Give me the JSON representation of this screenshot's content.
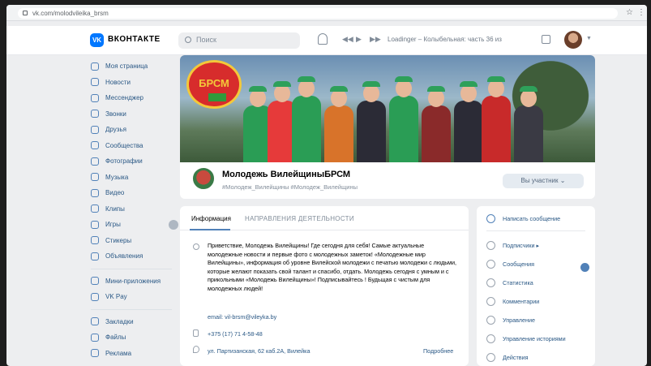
{
  "browser": {
    "url": "vk.com/molodvileika_brsm"
  },
  "header": {
    "logo_letters": "VK",
    "brand": "ВКОНТАКТЕ",
    "search_placeholder": "Поиск",
    "now_playing": "Loadinger – Колыбельная: часть 36 из"
  },
  "left_nav": {
    "items": [
      {
        "label": "Моя страница",
        "icon": "home-icon"
      },
      {
        "label": "Новости",
        "icon": "news-icon"
      },
      {
        "label": "Мессенджер",
        "icon": "chat-icon"
      },
      {
        "label": "Звонки",
        "icon": "phone-icon"
      },
      {
        "label": "Друзья",
        "icon": "friends-icon"
      },
      {
        "label": "Сообщества",
        "icon": "groups-icon"
      },
      {
        "label": "Фотографии",
        "icon": "photos-icon"
      },
      {
        "label": "Музыка",
        "icon": "music-icon"
      },
      {
        "label": "Видео",
        "icon": "video-icon"
      },
      {
        "label": "Клипы",
        "icon": "clips-icon"
      },
      {
        "label": "Игры",
        "icon": "games-icon"
      },
      {
        "label": "Стикеры",
        "icon": "stickers-icon"
      },
      {
        "label": "Объявления",
        "icon": "ads-icon"
      }
    ],
    "items2": [
      {
        "label": "Мини-приложения",
        "icon": "apps-icon"
      },
      {
        "label": "VK Pay",
        "icon": "vkpay-icon"
      }
    ],
    "items3": [
      {
        "label": "Закладки",
        "icon": "bookmark-icon"
      },
      {
        "label": "Файлы",
        "icon": "files-icon"
      },
      {
        "label": "Реклама",
        "icon": "ad-icon"
      }
    ]
  },
  "cover": {
    "logo_text": "БРСМ"
  },
  "group": {
    "name": "Молодежь ВилейщиныБРСМ",
    "status": "#Молодеж_Вилейщины #Молодеж_Вилейщины",
    "subscribe_label": "Вы участник ⌄"
  },
  "info": {
    "tab_info": "Информация",
    "tab_activity": "НАПРАВЛЕНИЯ ДЕЯТЕЛЬНОСТИ",
    "description": "Приветствие, Молодежь Вилейщины! Где сегодня для себя! Самые актуальные молодежные новости и первые фото с молодежных заметок! «Молодежные мир Вилейщины», информация об уровне Вилейской молодежи с печатью молодежи с людьми, которые желают показать свой талант и спасибо, отдать. Молодежь сегодня с умным и с прикольными «Молодежь Вилейщины»! Подписывайтесь ! Будьщая с чистым для молодежных людей!",
    "email": "email: vil-brsm@vileyka.by",
    "phone": "+375 (17) 71 4-58-48",
    "address": "ул. Партизанская, 62 каб.2А, Вилейка",
    "more": "Подробнее"
  },
  "actions": {
    "items": [
      {
        "label": "Написать сообщение",
        "primary": true
      },
      {
        "label": "Подписчики ▸"
      },
      {
        "label": "Сообщения"
      },
      {
        "label": "Статистика"
      },
      {
        "label": "Комментарии"
      },
      {
        "label": "Управление"
      },
      {
        "label": "Управление историями"
      },
      {
        "label": "Действия"
      }
    ]
  }
}
